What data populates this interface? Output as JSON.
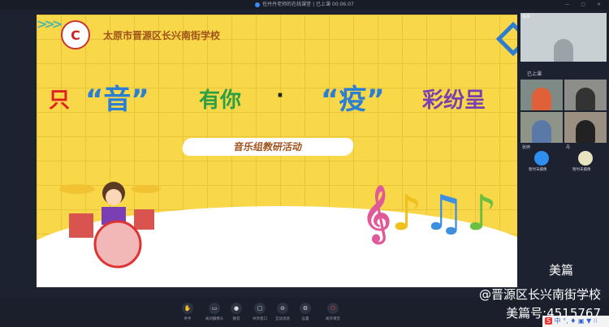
{
  "window": {
    "title": "任丹丹老师的在线课堂",
    "status": "已上课 00:06:07"
  },
  "slide": {
    "school": "太原市晋源区长兴南街学校",
    "headline": [
      {
        "t": "只",
        "c": "#e02020"
      },
      {
        "t": "“音”",
        "c": "#2a7fd4"
      },
      {
        "t": "有你",
        "c": "#2aa044"
      },
      {
        "t": "·",
        "c": "#222"
      },
      {
        "t": "“疫”",
        "c": "#2a7fd4"
      },
      {
        "t": "彩纷呈",
        "c": "#7a3fb0"
      }
    ],
    "subtitle": "音乐组教研活动"
  },
  "sidebar": {
    "teacher_label": "任丹",
    "section": "已上课",
    "cam_off_1_name": "张婷",
    "cam_off_1_status": "暂时未摄像",
    "cam_off_2_name": "丹",
    "cam_off_2_status": "暂时未摄像"
  },
  "toolbar": [
    {
      "label": "举手",
      "icon": "hand-icon"
    },
    {
      "label": "关闭摄像头",
      "icon": "camera-icon"
    },
    {
      "label": "静音",
      "icon": "mic-icon"
    },
    {
      "label": "共享窗口",
      "icon": "screen-share-icon"
    },
    {
      "label": "互动消息",
      "icon": "message-icon"
    },
    {
      "label": "设置",
      "icon": "gear-icon"
    },
    {
      "label": "离开课堂",
      "icon": "power-icon"
    }
  ],
  "watermark": {
    "logo": "美篇",
    "line1": "@晋源区长兴南街学校",
    "line2": "美篇号:4515767"
  },
  "ime": "中 °, ♦ ▣ ▼ ⁝⁝"
}
